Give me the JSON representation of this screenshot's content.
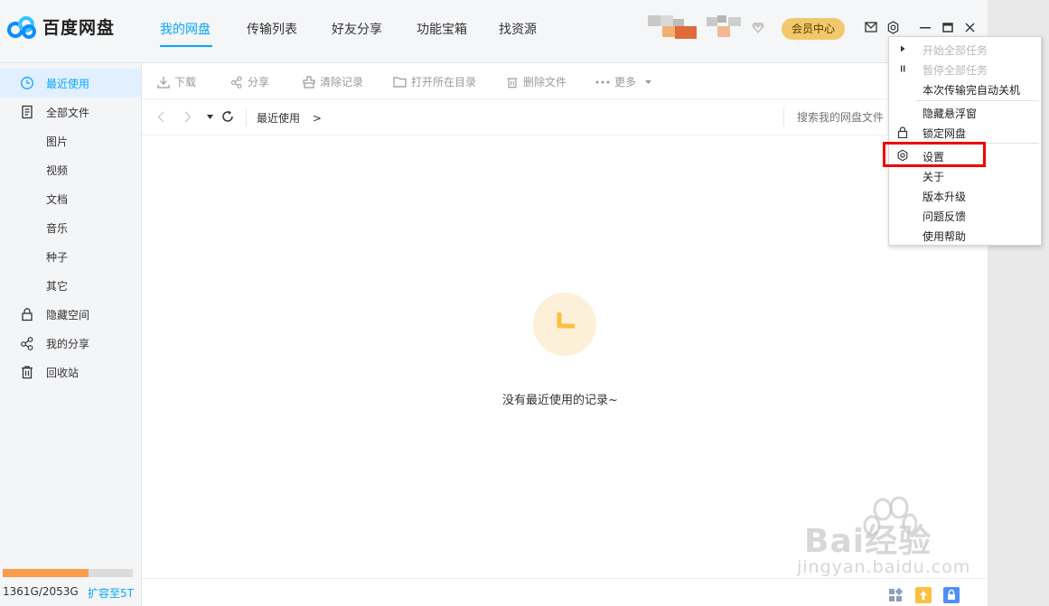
{
  "app": {
    "name": "百度网盘"
  },
  "nav": {
    "tabs": [
      {
        "label": "我的网盘",
        "active": true
      },
      {
        "label": "传输列表"
      },
      {
        "label": "好友分享"
      },
      {
        "label": "功能宝箱"
      },
      {
        "label": "找资源"
      }
    ],
    "vip_label": "会员中心"
  },
  "sidebar": {
    "items": [
      {
        "label": "最近使用",
        "icon": "clock-icon",
        "active": true
      },
      {
        "label": "全部文件",
        "icon": "document-icon"
      },
      {
        "label": "图片"
      },
      {
        "label": "视频"
      },
      {
        "label": "文档"
      },
      {
        "label": "音乐"
      },
      {
        "label": "种子"
      },
      {
        "label": "其它"
      },
      {
        "label": "隐藏空间",
        "icon": "lock-icon"
      },
      {
        "label": "我的分享",
        "icon": "share-icon"
      },
      {
        "label": "回收站",
        "icon": "trash-icon"
      }
    ],
    "quota": {
      "text": "1361G/2053G",
      "used_fraction": 0.663,
      "expand_label": "扩容至5T"
    }
  },
  "toolbar": {
    "download": "下载",
    "share": "分享",
    "clear": "清除记录",
    "open_folder": "打开所在目录",
    "delete": "删除文件",
    "more": "更多"
  },
  "path": {
    "breadcrumb": "最近使用",
    "breadcrumb_arrow": ">",
    "search_placeholder": "搜索我的网盘文件"
  },
  "main": {
    "empty_text": "没有最近使用的记录~"
  },
  "menu": {
    "items": [
      {
        "label": "开始全部任务",
        "disabled": true,
        "icon": "play-icon"
      },
      {
        "label": "暂停全部任务",
        "disabled": true,
        "icon": "pause-icon"
      },
      {
        "label": "本次传输完自动关机"
      },
      {
        "label": "隐藏悬浮窗"
      },
      {
        "label": "锁定网盘",
        "icon": "lock-icon"
      },
      {
        "label": "设置",
        "icon": "gear-icon"
      },
      {
        "label": "关于"
      },
      {
        "label": "版本升级"
      },
      {
        "label": "问题反馈"
      },
      {
        "label": "使用帮助"
      }
    ]
  },
  "watermark": {
    "brand": "Bai经验",
    "url": "jingyan.baidu.com"
  },
  "colors": {
    "accent": "#06a7ff",
    "vip": "#f1c86b",
    "quota": "#fb9d4a",
    "highlight": "#f00000"
  }
}
